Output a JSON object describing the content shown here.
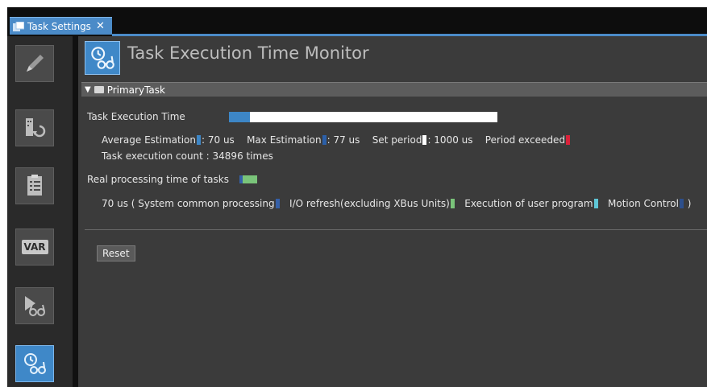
{
  "tab": {
    "title": "Task Settings",
    "close_label": "✕"
  },
  "toolbar": {
    "items": [
      {
        "icon": "pencil-icon"
      },
      {
        "icon": "io-mapping-icon"
      },
      {
        "icon": "list-icon"
      },
      {
        "icon": "var-icon",
        "label": "VAR"
      },
      {
        "icon": "simulation-monitor-icon"
      },
      {
        "icon": "task-monitor-icon",
        "active": true
      }
    ]
  },
  "header": {
    "title": "Task Execution Time Monitor"
  },
  "section": {
    "name": "PrimaryTask",
    "expanded": true
  },
  "execution": {
    "label": "Task Execution Time",
    "bar_fill_fraction": 0.077,
    "average_label": "Average Estimation",
    "average_value": ": 70 us",
    "max_label": "Max Estimation",
    "max_value": ": 77 us",
    "set_period_label": "Set period",
    "set_period_value": ": 1000 us",
    "period_exceeded_label": "Period exceeded",
    "count_text": "Task execution count : 34896 times"
  },
  "real_processing": {
    "label": "Real processing time of tasks",
    "value_text": "70 us ( System common processing",
    "io_refresh_label": "I/O refresh(excluding XBus Units)",
    "user_program_label": "Execution of user program",
    "motion_control_label": "Motion Control",
    "close_paren": ")"
  },
  "colors": {
    "average": "#3d86c6",
    "max": "#2b5fa8",
    "set_period": "#ffffff",
    "period_exceeded": "#d9223a",
    "system_common": "#3560a8",
    "io_refresh": "#7ac47a",
    "user_program": "#5fc6d6",
    "motion_control": "#2d4f8c"
  },
  "reset_button": {
    "label": "Reset"
  }
}
